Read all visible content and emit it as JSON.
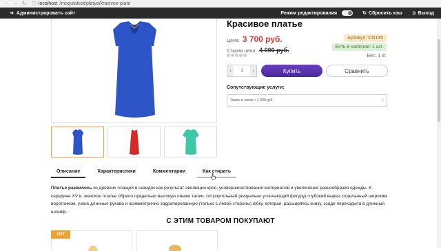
{
  "browser": {
    "url_host": "localhost",
    "url_path": "/mogutatest/platya/krasivoe-plate"
  },
  "admin_bar": {
    "admin_label": "Администрировать сайт",
    "edit_mode_label": "Режим редактирования",
    "clear_cache_label": "Сбросить кэш",
    "logout_label": "Выход"
  },
  "product": {
    "title": "Красивое платье",
    "price_label": "Цена:",
    "price": "3 700 руб.",
    "old_price_label": "Старая цена:",
    "old_price": "4 000 руб.",
    "sku": "Артикул: CN135",
    "stock": "Есть в наличии: 1 шт.",
    "weight": "Вес: 1 кг.",
    "quantity": "1",
    "buy_label": "Купить",
    "compare_label": "Сравнить",
    "rating": 0,
    "rating_max": 5
  },
  "services": {
    "title": "Сопутствующие услуги:",
    "selected": "Ушить в талии + 1 000 руб."
  },
  "thumbnails": [
    {
      "color": "#2e55c8",
      "label": "blue-dress"
    },
    {
      "color": "#d42a2a",
      "label": "red-dress"
    },
    {
      "color": "#3cc7a8",
      "label": "mint-dress"
    }
  ],
  "tabs": [
    {
      "label": "Описание"
    },
    {
      "label": "Характеристики"
    },
    {
      "label": "Комментарии"
    },
    {
      "label": "Как стирать"
    }
  ],
  "description": {
    "lead": "Платье развилось",
    "text": " из древних плащей и накидок как результат эволюции кроя, усовершенствования материалов и увеличения разнообразия одежды. К середине XV в. женское платье обрело предельно высокую линию талии, остроугольный (визуально утончающий фигуру) глубокий вырез, отделанный широким воротником, узкие длинные рукава и асимметрично задрапированную (только с левой стороны) юбку, которая, расширяясь книзу, сзади переходила в длинный шлейф."
  },
  "also_bought": {
    "title": "С ЭТИМ ТОВАРОМ ПОКУПАЮТ",
    "badge": "ХИТ"
  },
  "colors": {
    "price_red": "#d83a3a",
    "buy_purple": "#5a34ad",
    "hit_orange": "#f0a030",
    "main_dress": "#2e55c8"
  }
}
